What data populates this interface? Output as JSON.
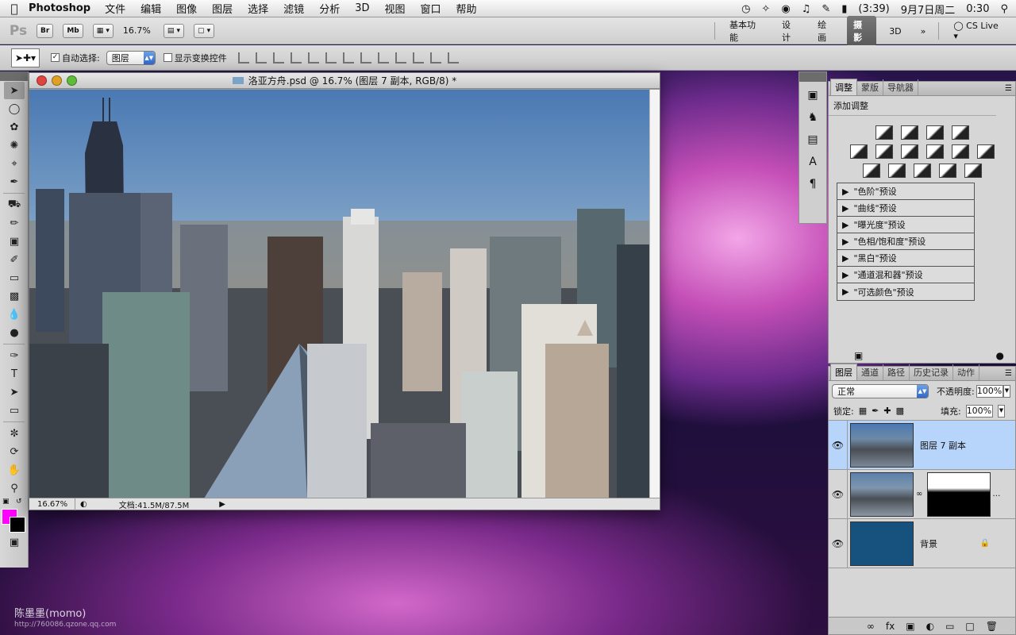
{
  "menubar": {
    "app_name": "Photoshop",
    "items": [
      "文件",
      "编辑",
      "图像",
      "图层",
      "选择",
      "滤镜",
      "分析",
      "3D",
      "视图",
      "窗口",
      "帮助"
    ],
    "battery": "(3:39)",
    "datetime": "9月7日周二",
    "time": "0:30"
  },
  "appbar": {
    "logo": "Ps",
    "br": "Br",
    "mb": "Mb",
    "zoom": "16.7%",
    "workspaces": [
      "基本功能",
      "设计",
      "绘画",
      "摄影",
      "3D"
    ],
    "active_workspace": "摄影",
    "cslive": "CS Live"
  },
  "options": {
    "auto_select_label": "自动选择:",
    "auto_select_value": "图层",
    "show_transform_label": "显示变换控件"
  },
  "document": {
    "title": "洛亚方舟.psd @ 16.7% (图层 7 副本, RGB/8) *",
    "zoom": "16.67%",
    "docsize": "文档:41.5M/87.5M"
  },
  "adjustments": {
    "tabs": [
      "调整",
      "蒙版",
      "导航器"
    ],
    "title": "添加调整",
    "presets": [
      "\"色阶\"预设",
      "\"曲线\"预设",
      "\"曝光度\"预设",
      "\"色相/饱和度\"预设",
      "\"黑白\"预设",
      "\"通道混和器\"预设",
      "\"可选颜色\"预设"
    ]
  },
  "layers_panel": {
    "tabs": [
      "图层",
      "通道",
      "路径",
      "历史记录",
      "动作"
    ],
    "blend_mode": "正常",
    "opacity_label": "不透明度:",
    "opacity": "100%",
    "lock_label": "锁定:",
    "fill_label": "填充:",
    "fill": "100%",
    "layers": [
      {
        "name": "图层 7 副本",
        "selected": true
      },
      {
        "name": "",
        "selected": false
      },
      {
        "name": "背景",
        "selected": false
      }
    ]
  },
  "colors": {
    "foreground": "#ff00ff",
    "background": "#000000",
    "layer_bg": "#17527f",
    "selected_layer": "#b7d5fb"
  },
  "watermark": {
    "name": "陈墨墨(momo)",
    "url": "http://760086.qzone.qq.com"
  }
}
